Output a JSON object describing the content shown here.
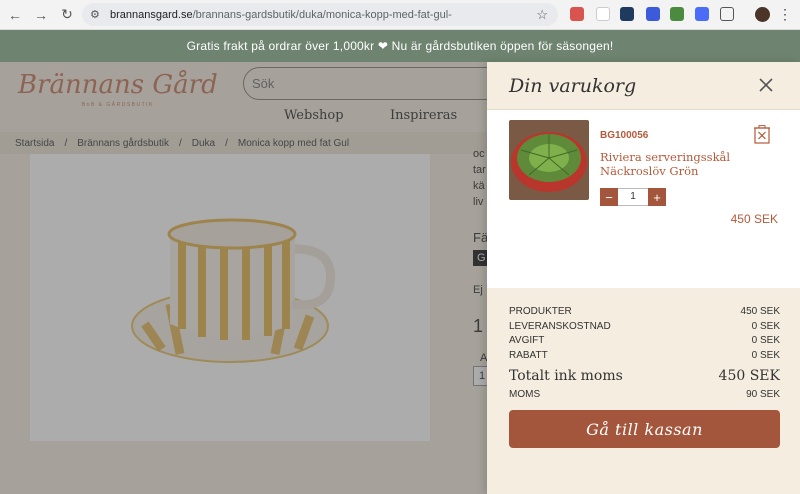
{
  "browser": {
    "url_host": "brannansgard.se",
    "url_path": "/brannans-gardsbutik/duka/monica-kopp-med-fat-gul-"
  },
  "banner": {
    "text": "Gratis frakt på ordrar över 1,000kr ❤ Nu är gårdsbutiken öppen för säsongen!"
  },
  "site": {
    "logo": "Brännans Gård",
    "logo_tagline": "BnB & GÅRDSBUTIK",
    "search_placeholder": "Sök",
    "menu": [
      "Webshop",
      "Inspireras"
    ],
    "breadcrumb": [
      "Startsida",
      "Brännans gårdsbutik",
      "Duka",
      "Monica kopp med fat Gul"
    ],
    "right_fragments": [
      "oc",
      "tar",
      "kä",
      "liv",
      "Fä",
      "G",
      "Ej",
      "1",
      "A",
      "1"
    ]
  },
  "cart": {
    "title": "Din varukorg",
    "item": {
      "sku": "BG100056",
      "name": "Riviera serveringsskål Näckroslöv Grön",
      "qty": "1",
      "price": "450 SEK"
    },
    "summary": {
      "products_label": "PRODUKTER",
      "products_value": "450 SEK",
      "shipping_label": "LEVERANSKOSTNAD",
      "shipping_value": "0 SEK",
      "fee_label": "AVGIFT",
      "fee_value": "0 SEK",
      "discount_label": "RABATT",
      "discount_value": "0 SEK",
      "total_label": "Totalt ink moms",
      "total_value": "450 SEK",
      "vat_label": "MOMS",
      "vat_value": "90 SEK"
    },
    "checkout_label": "Gå till kassan",
    "colors": {
      "accent": "#a4563c",
      "accent_text": "#b5593a",
      "drawer_bg": "#f4ede0"
    }
  }
}
